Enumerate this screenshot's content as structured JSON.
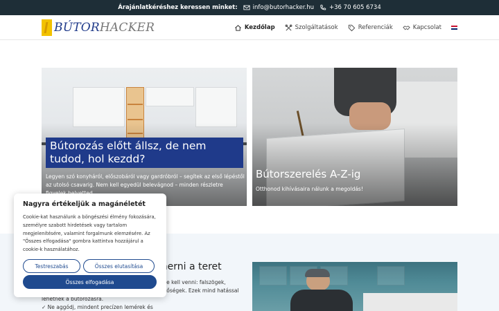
{
  "topbar": {
    "cta": "Árajánlatkéréshez keressen minket:",
    "email": "info@butorhacker.hu",
    "phone": "+36 70 605 6734"
  },
  "logo": {
    "part1": "BÚTOR",
    "part2": "HACKER"
  },
  "nav": {
    "items": [
      {
        "label": "Kezdőlap",
        "icon": "home-icon"
      },
      {
        "label": "Szolgáltatások",
        "icon": "tools-icon"
      },
      {
        "label": "Referenciák",
        "icon": "tag-icon"
      },
      {
        "label": "Kapcsolat",
        "icon": "handshake-icon"
      }
    ],
    "language": "english-flag-icon"
  },
  "cards": [
    {
      "title": "Bútorozás előtt állsz, de nem tudod, hol kezdd?",
      "description": "Legyen szó konyháról, előszobáról vagy gardróbról – segítek az első lépéstől az utolsó csavarig. Nem kell egyedül belevágnod – minden részletre figyelek helyetted."
    },
    {
      "title": "Bútorszerelés A-Z-ig",
      "description": "Otthonod kihívásaira nálunk a megoldás!"
    }
  ],
  "section2": {
    "heading": "merni a teret",
    "text": "mbe kell venni: falszögek, hetőségek. Ezek mind hatással",
    "text_left_1": "lehetnek a bútorozásra.",
    "text_left_2": "✓ Ne aggódj, mindent precízen lemérek és dokumentálok helyetted"
  },
  "cookie": {
    "title": "Nagyra értékeljük a magánéletét",
    "text": "Cookie-kat használunk a böngészési élmény fokozására, személyre szabott hirdetések vagy tartalom megjelenítésére, valamint forgalmunk elemzésére. Az \"Összes elfogadása\" gombra kattintva hozzájárul a cookie-k használatához.",
    "customize": "Testreszabás",
    "reject": "Összes elutasítása",
    "accept": "Összes elfogadása"
  },
  "colors": {
    "topbar": "#1e2e37",
    "brand_blue": "#1f3a8a",
    "button_blue": "#1f4a8f",
    "logo_yellow": "#f2c200"
  }
}
